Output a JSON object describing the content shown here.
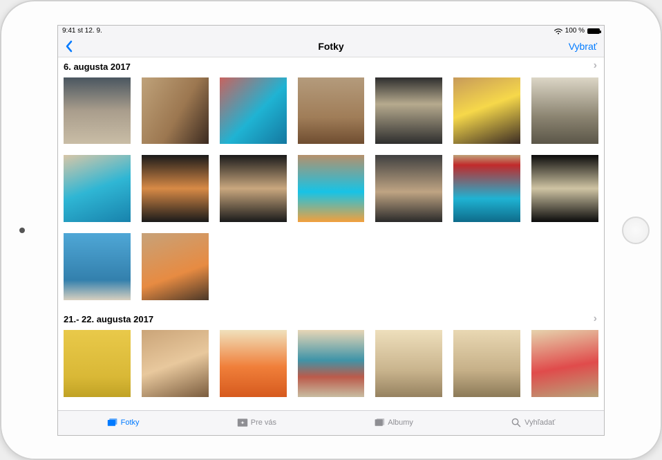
{
  "statusbar": {
    "time": "9:41",
    "date": "st 12. 9.",
    "battery_pct": "100 %"
  },
  "navbar": {
    "title": "Fotky",
    "select_label": "Vybrať"
  },
  "sections": [
    {
      "header": "6. augusta 2017",
      "thumbs": [
        {
          "bg": "linear-gradient(180deg,#4a5660 0%,#a99d8c 50%,#c9bda6 100%)"
        },
        {
          "bg": "linear-gradient(120deg,#bfa27a 0%,#9c7750 55%,#3b2a20 100%)"
        },
        {
          "bg": "linear-gradient(135deg,#c8635f 0%,#1fb3d3 55%,#1478a0 100%)"
        },
        {
          "bg": "linear-gradient(180deg,#b49b7c 0%,#a07d58 60%,#6f4d30 100%)"
        },
        {
          "bg": "linear-gradient(180deg,#2e2e2e 0%,#b6aa8e 40%,#2e2e2e 100%)"
        },
        {
          "bg": "linear-gradient(160deg,#c79a5a 0%,#f6d84a 45%,#3a2b24 100%)"
        },
        {
          "bg": "linear-gradient(180deg,#dcd6c6 0%,#8a8370 60%,#5b5648 100%)"
        },
        {
          "bg": "linear-gradient(160deg,#d8c6a7 0%,#2fb6d4 50%,#1882ac 100%)"
        },
        {
          "bg": "linear-gradient(180deg,#1a1a1a 0%,#d88a46 50%,#1a1a1a 100%)"
        },
        {
          "bg": "linear-gradient(180deg,#1a1a1a 0%,#c9a77e 50%,#1a1a1a 100%)"
        },
        {
          "bg": "linear-gradient(180deg,#b5906c 0%,#17c3e6 55%,#f2a03d 100%)"
        },
        {
          "bg": "linear-gradient(180deg,#404040 0%,#bfa483 55%,#2a2a2a 100%)"
        },
        {
          "bg": "linear-gradient(180deg,#bfa27a 0%,#c12a2b 15%,#1fb3d3 65%,#0e6b8a 100%)"
        },
        {
          "bg": "linear-gradient(180deg,#0b0b0b 0%,#cfc4a3 50%,#0b0b0b 100%)"
        },
        {
          "bg": "linear-gradient(180deg,#4fa7d6 0%,#3380ad 70%,#d8d0bf 100%)"
        },
        {
          "bg": "linear-gradient(160deg,#c7a279 0%,#e78b42 60%,#4a3728 100%)"
        }
      ]
    },
    {
      "header": "21.- 22. augusta 2017",
      "thumbs": [
        {
          "bg": "linear-gradient(180deg,#e9c94a 0%,#d9b836 70%,#c0a225 100%)"
        },
        {
          "bg": "linear-gradient(160deg,#caa478 0%,#e8c89d 50%,#7a5c3e 100%)"
        },
        {
          "bg": "linear-gradient(180deg,#f0e1bc 0%,#f07f3a 55%,#d65a1e 100%)"
        },
        {
          "bg": "linear-gradient(180deg,#e7d6b6 0%,#3f94a8 45%,#bb5a4a 70%,#c8bda2 100%)"
        },
        {
          "bg": "linear-gradient(180deg,#eedfbc 0%,#c9b48d 60%,#968260 100%)"
        },
        {
          "bg": "linear-gradient(180deg,#e9d8b3 0%,#c6b088 60%,#8c7a58 100%)"
        },
        {
          "bg": "linear-gradient(170deg,#e6d3ad 0%,#e04b4b 55%,#b8a37a 100%)"
        }
      ]
    }
  ],
  "tabs": [
    {
      "id": "photos",
      "label": "Fotky",
      "active": true
    },
    {
      "id": "foryou",
      "label": "Pre vás",
      "active": false
    },
    {
      "id": "albums",
      "label": "Albumy",
      "active": false
    },
    {
      "id": "search",
      "label": "Vyhľadať",
      "active": false
    }
  ]
}
